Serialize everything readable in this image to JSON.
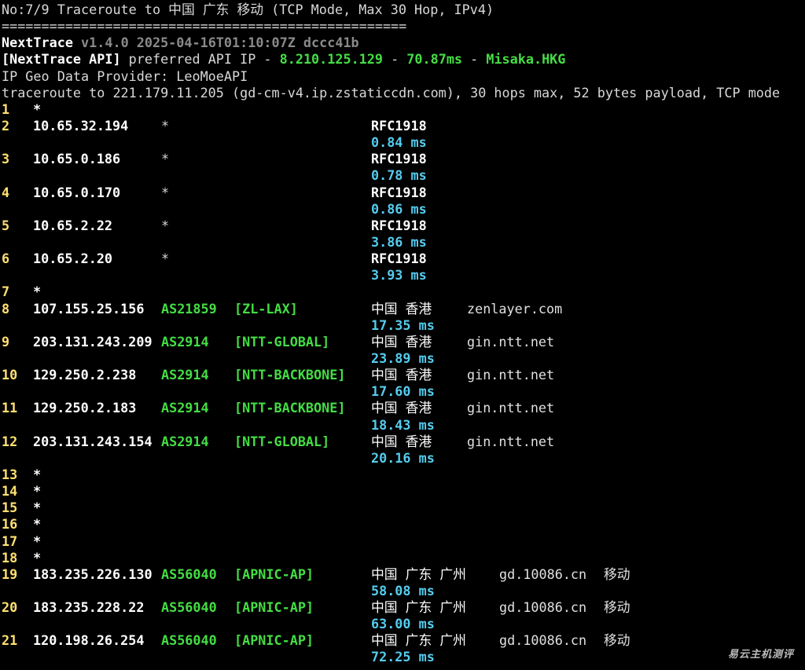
{
  "header": {
    "title": "No:7/9 Traceroute to 中国 广东 移动 (TCP Mode, Max 30 Hop, IPv4)",
    "separator": "===================================================",
    "app_name": "NextTrace",
    "version_info": "v1.4.0 2025-04-16T01:10:07Z dccc41b",
    "api_label": "[NextTrace API]",
    "api_text": " preferred API IP - ",
    "api_ip": "8.210.125.129",
    "dash1": " - ",
    "api_latency": "70.87ms",
    "dash2": " - ",
    "api_node": "Misaka.HKG",
    "geo_provider": "IP Geo Data Provider: LeoMoeAPI",
    "traceroute_line": "traceroute to 221.179.11.205 (gd-cm-v4.ip.zstaticcdn.com), 30 hops max, 52 bytes payload, TCP mode"
  },
  "hops": [
    {
      "hop": "1",
      "ip": "*"
    },
    {
      "hop": "2",
      "ip": "10.65.32.194",
      "asn": "*",
      "geo": "RFC1918",
      "rtt": "0.84 ms"
    },
    {
      "hop": "3",
      "ip": "10.65.0.186",
      "asn": "*",
      "geo": "RFC1918",
      "rtt": "0.78 ms"
    },
    {
      "hop": "4",
      "ip": "10.65.0.170",
      "asn": "*",
      "geo": "RFC1918",
      "rtt": "0.86 ms"
    },
    {
      "hop": "5",
      "ip": "10.65.2.22",
      "asn": "*",
      "geo": "RFC1918",
      "rtt": "3.86 ms"
    },
    {
      "hop": "6",
      "ip": "10.65.2.20",
      "asn": "*",
      "geo": "RFC1918",
      "rtt": "3.93 ms"
    },
    {
      "hop": "7",
      "ip": "*"
    },
    {
      "hop": "8",
      "ip": "107.155.25.156",
      "asn": "AS21859",
      "tag": "[ZL-LAX]",
      "geo": "中国 香港",
      "host": "zenlayer.com",
      "rtt": "17.35 ms"
    },
    {
      "hop": "9",
      "ip": "203.131.243.209",
      "asn": "AS2914",
      "tag": "[NTT-GLOBAL]",
      "geo": "中国 香港",
      "host": "gin.ntt.net",
      "rtt": "23.89 ms"
    },
    {
      "hop": "10",
      "ip": "129.250.2.238",
      "asn": "AS2914",
      "tag": "[NTT-BACKBONE]",
      "geo": "中国 香港",
      "host": "gin.ntt.net",
      "rtt": "17.60 ms"
    },
    {
      "hop": "11",
      "ip": "129.250.2.183",
      "asn": "AS2914",
      "tag": "[NTT-BACKBONE]",
      "geo": "中国 香港",
      "host": "gin.ntt.net",
      "rtt": "18.43 ms"
    },
    {
      "hop": "12",
      "ip": "203.131.243.154",
      "asn": "AS2914",
      "tag": "[NTT-GLOBAL]",
      "geo": "中国 香港",
      "host": "gin.ntt.net",
      "rtt": "20.16 ms"
    },
    {
      "hop": "13",
      "ip": "*"
    },
    {
      "hop": "14",
      "ip": "*"
    },
    {
      "hop": "15",
      "ip": "*"
    },
    {
      "hop": "16",
      "ip": "*"
    },
    {
      "hop": "17",
      "ip": "*"
    },
    {
      "hop": "18",
      "ip": "*"
    },
    {
      "hop": "19",
      "ip": "183.235.226.130",
      "asn": "AS56040",
      "tag": "[APNIC-AP]",
      "geo": "中国 广东 广州",
      "host": "gd.10086.cn",
      "isp": "移动",
      "rtt": "58.08 ms"
    },
    {
      "hop": "20",
      "ip": "183.235.228.22",
      "asn": "AS56040",
      "tag": "[APNIC-AP]",
      "geo": "中国 广东 广州",
      "host": "gd.10086.cn",
      "isp": "移动",
      "rtt": "63.00 ms"
    },
    {
      "hop": "21",
      "ip": "120.198.26.254",
      "asn": "AS56040",
      "tag": "[APNIC-AP]",
      "geo": "中国 广东 广州",
      "host": "gd.10086.cn",
      "isp": "移动",
      "rtt": "72.25 ms"
    }
  ],
  "watermark": "易云主机测评"
}
